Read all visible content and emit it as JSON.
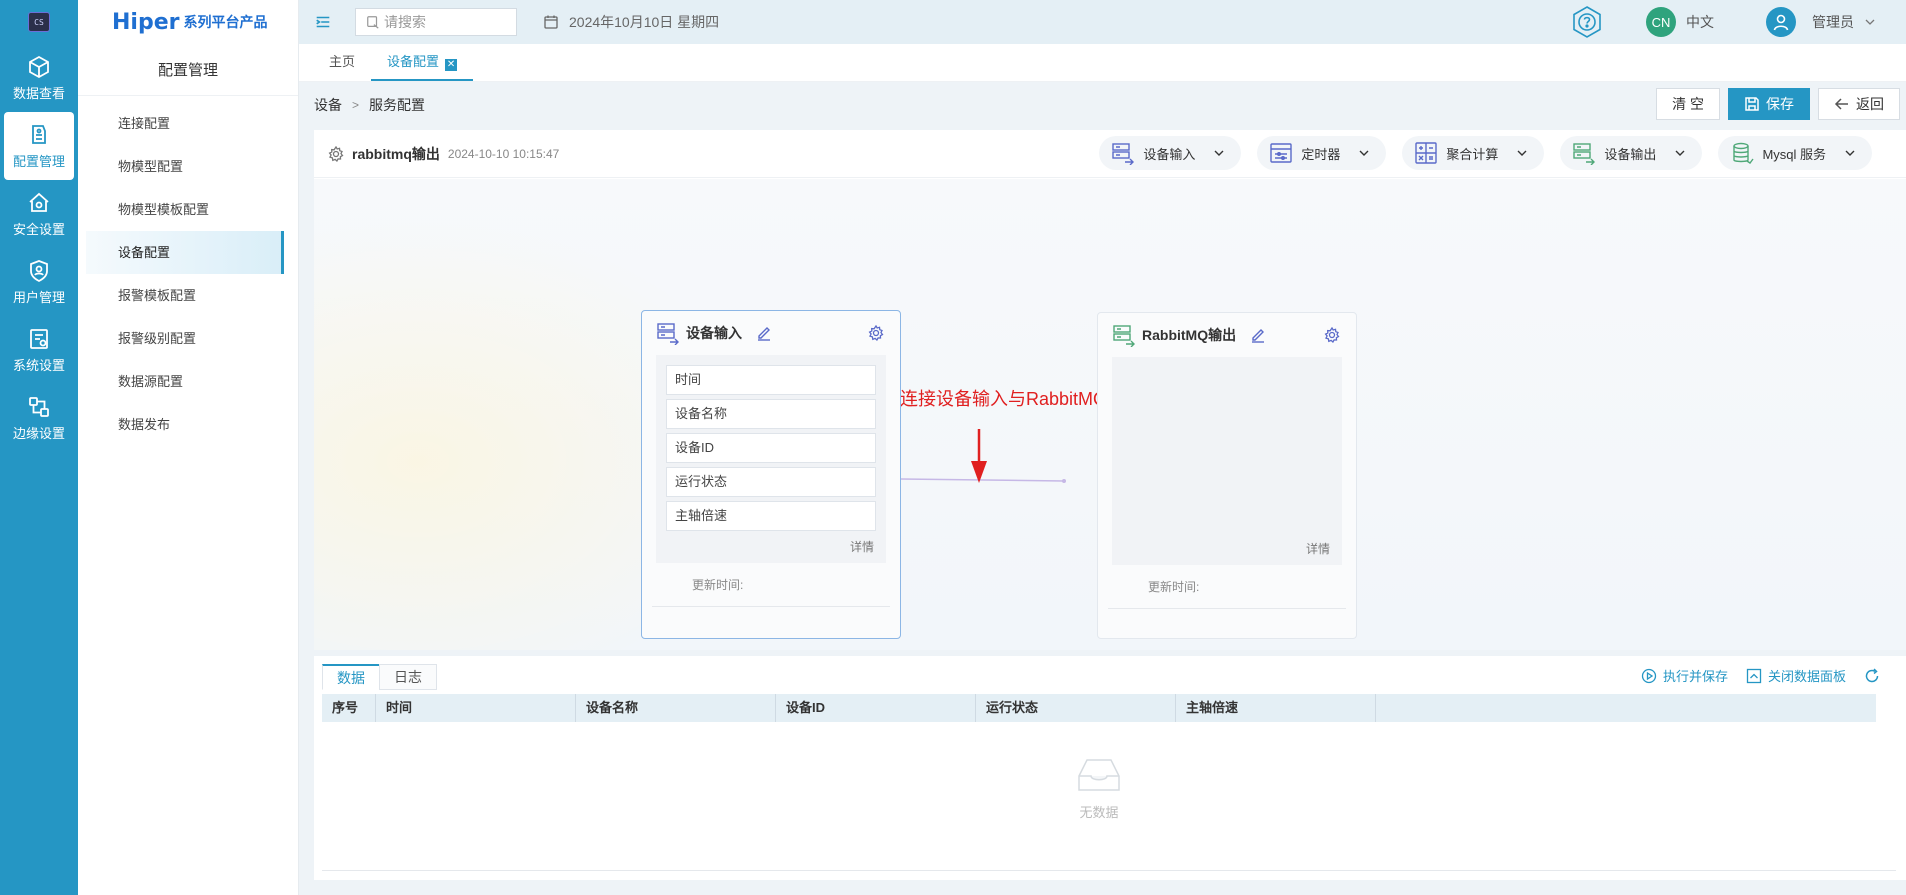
{
  "rail": {
    "logo_text": "CS",
    "items": [
      {
        "label": "数据查看",
        "icon": "data-view-icon"
      },
      {
        "label": "配置管理",
        "icon": "config-icon"
      },
      {
        "label": "安全设置",
        "icon": "security-icon"
      },
      {
        "label": "用户管理",
        "icon": "user-shield-icon"
      },
      {
        "label": "系统设置",
        "icon": "system-icon"
      },
      {
        "label": "边缘设置",
        "icon": "edge-icon"
      }
    ]
  },
  "brand": {
    "main": "Hiper",
    "sub": "系列平台产品"
  },
  "sidebar": {
    "title": "配置管理",
    "items": [
      "连接配置",
      "物模型配置",
      "物模型模板配置",
      "设备配置",
      "报警模板配置",
      "报警级别配置",
      "数据源配置",
      "数据发布"
    ]
  },
  "header": {
    "search_placeholder": "请搜索",
    "date": "2024年10月10日 星期四",
    "lang_badge": "CN",
    "lang": "中文",
    "user": "管理员"
  },
  "tabs": [
    {
      "label": "主页"
    },
    {
      "label": "设备配置"
    }
  ],
  "breadcrumb": {
    "root": "设备",
    "sep": ">",
    "current": "服务配置"
  },
  "actions": {
    "clear": "清 空",
    "save": "保存",
    "back": "返回"
  },
  "flow": {
    "name": "rabbitmq输出",
    "time": "2024-10-10 10:15:47",
    "node_types": [
      "设备输入",
      "定时器",
      "聚合计算",
      "设备输出",
      "Mysql 服务"
    ]
  },
  "nodes": {
    "input": {
      "title": "设备输入",
      "fields": [
        "时间",
        "设备名称",
        "设备ID",
        "运行状态",
        "主轴倍速"
      ],
      "detail": "详情",
      "updated": "更新时间:"
    },
    "output": {
      "title": "RabbitMQ输出",
      "detail": "详情",
      "updated": "更新时间:"
    }
  },
  "annotation": "连接设备输入与RabbitMQ输出",
  "data_panel": {
    "tabs": [
      "数据",
      "日志"
    ],
    "run_save": "执行并保存",
    "close_panel": "关闭数据面板",
    "columns": [
      "序号",
      "时间",
      "设备名称",
      "设备ID",
      "运行状态",
      "主轴倍速"
    ],
    "empty": "无数据"
  },
  "colors": {
    "accent": "#2596c4",
    "annotation": "#e02020",
    "brand": "#1f6fd1"
  }
}
